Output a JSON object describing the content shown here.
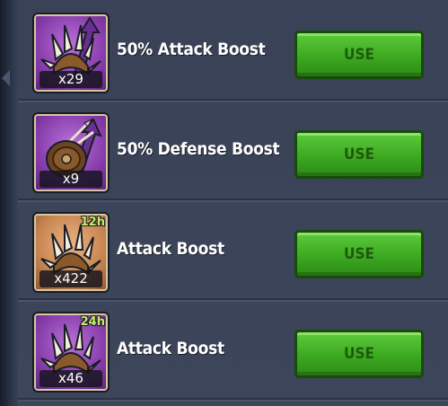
{
  "colors": {
    "background": "#3c4559",
    "use_button": "#3aa51f",
    "use_text": "#1d5b0b",
    "duration_text": "#c7ee6a",
    "icon_purple": "#8a3fae",
    "icon_orange": "#c98752"
  },
  "items": [
    {
      "name": "50% Attack Boost",
      "count": "x29",
      "duration": "",
      "icon": "attack-spikes-icon",
      "frame": "purple",
      "button": "USE"
    },
    {
      "name": "50% Defense Boost",
      "count": "x9",
      "duration": "",
      "icon": "defense-shield-icon",
      "frame": "purple",
      "button": "USE"
    },
    {
      "name": "Attack Boost",
      "count": "x422",
      "duration": "12h",
      "icon": "attack-spikes-icon",
      "frame": "orange",
      "button": "USE"
    },
    {
      "name": "Attack Boost",
      "count": "x46",
      "duration": "24h",
      "icon": "attack-spikes-icon",
      "frame": "purple",
      "button": "USE"
    }
  ]
}
